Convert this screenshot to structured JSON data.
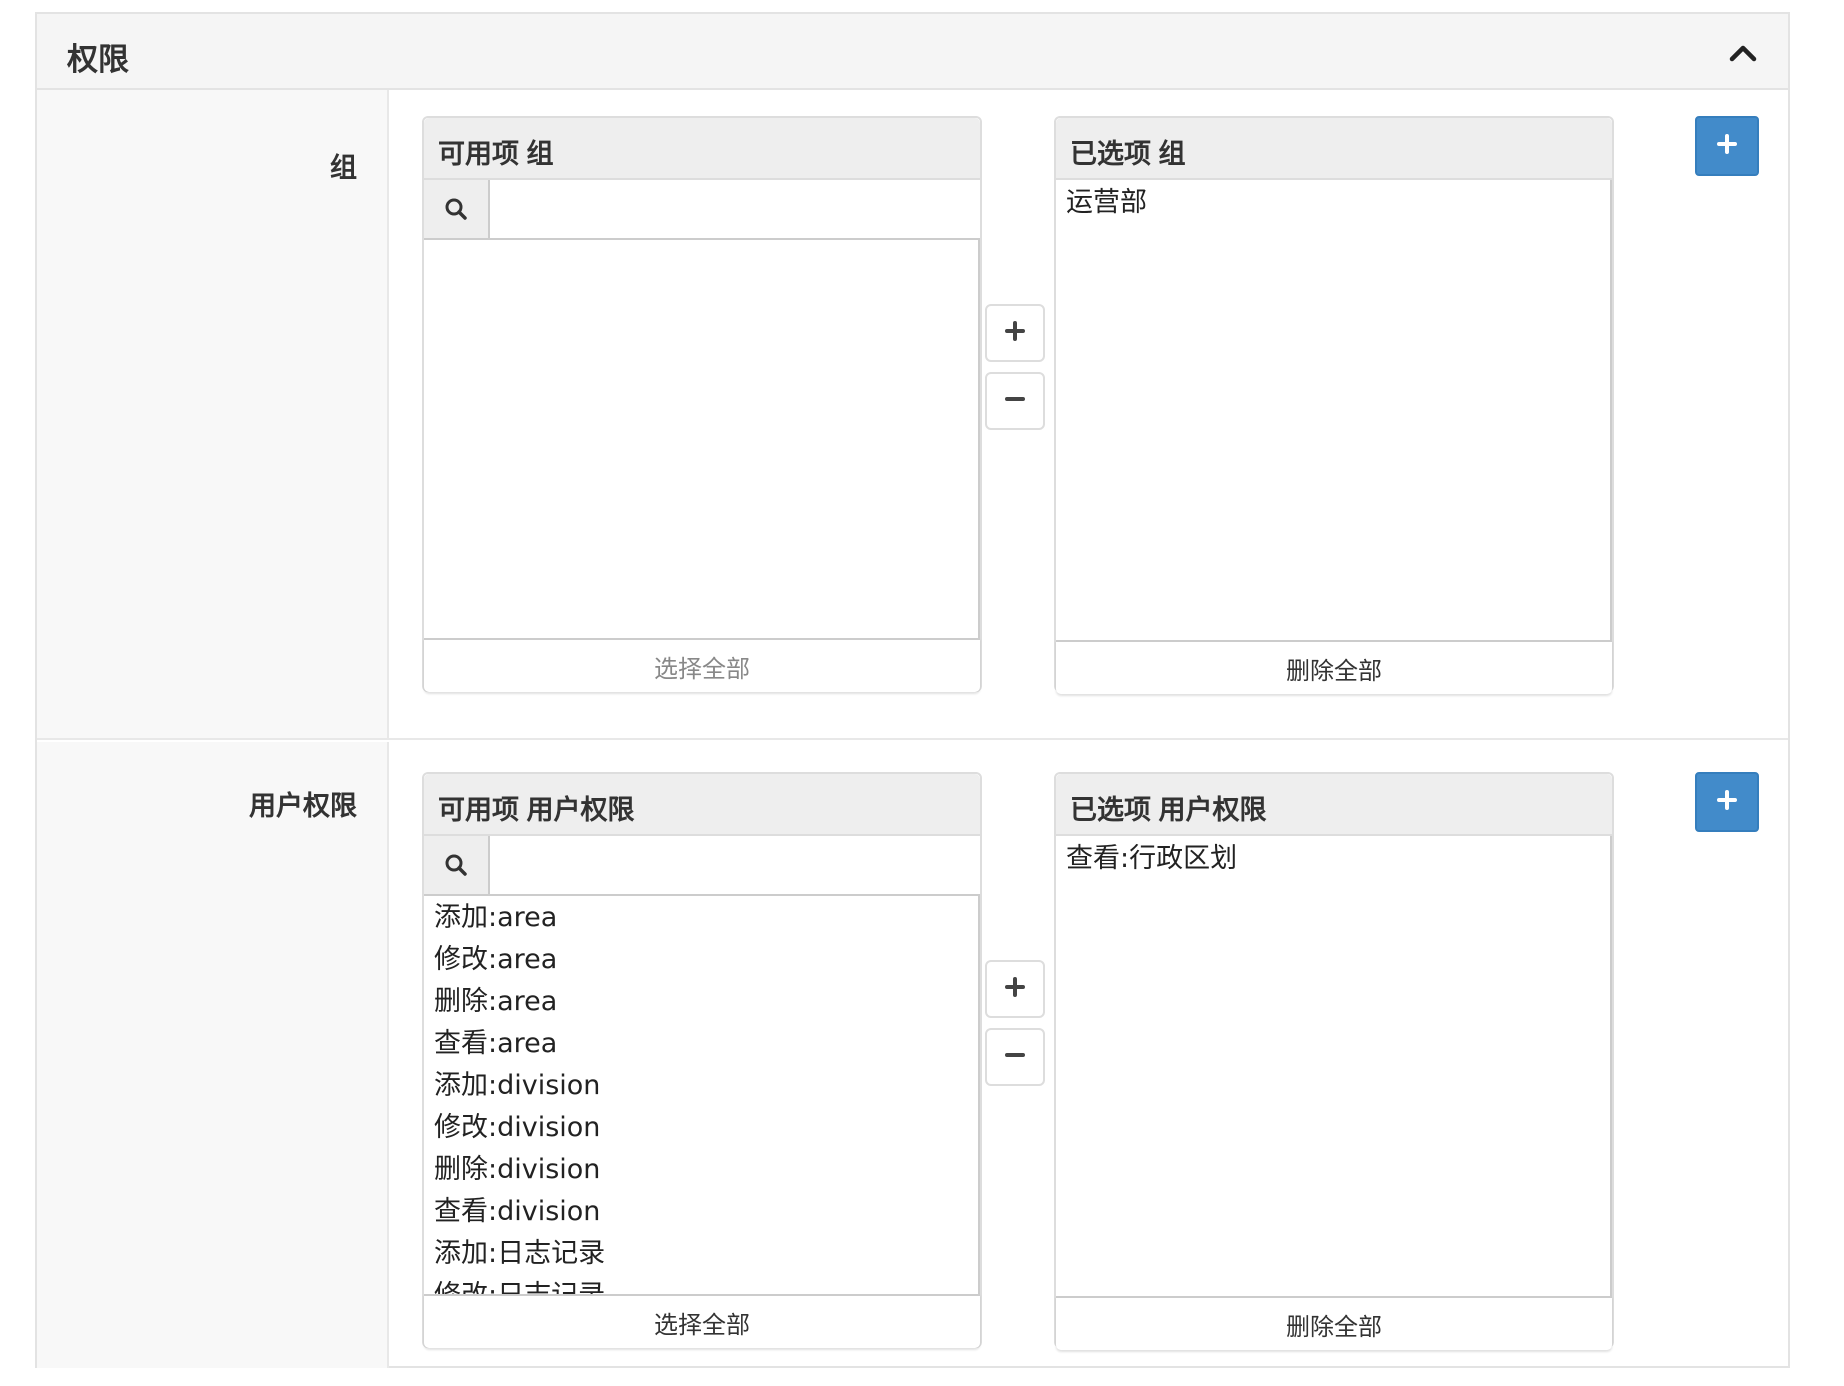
{
  "panel": {
    "title": "权限"
  },
  "sections": [
    {
      "label": "组",
      "available": {
        "title": "可用项 组",
        "search_value": "",
        "items": [],
        "footer_label": "选择全部"
      },
      "chosen": {
        "title": "已选项 组",
        "items": [
          "运营部"
        ],
        "footer_label": "删除全部"
      }
    },
    {
      "label": "用户权限",
      "available": {
        "title": "可用项 用户权限",
        "search_value": "",
        "items": [
          "添加:area",
          "修改:area",
          "删除:area",
          "查看:area",
          "添加:division",
          "修改:division",
          "删除:division",
          "查看:division",
          "添加:日志记录",
          "修改:日志记录"
        ],
        "footer_label": "选择全部"
      },
      "chosen": {
        "title": "已选项 用户权限",
        "items": [
          "查看:行政区划"
        ],
        "footer_label": "删除全部"
      }
    }
  ],
  "icons": {
    "collapse": "chevron-up-icon",
    "search": "search-icon",
    "move_right": "plus-icon",
    "move_left": "minus-icon",
    "add_related": "plus-icon"
  },
  "colors": {
    "primary": "#428bca",
    "header_bg": "#f5f5f5",
    "border": "#dddddd"
  }
}
